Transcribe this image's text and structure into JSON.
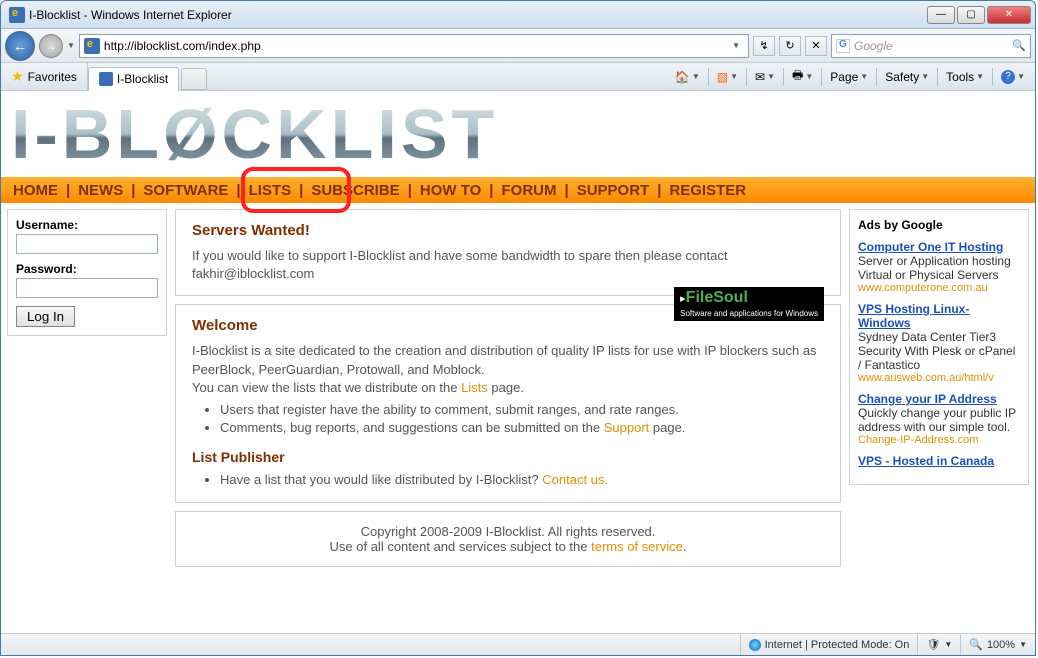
{
  "window": {
    "title": "I-Blocklist - Windows Internet Explorer"
  },
  "address": {
    "url": "http://iblocklist.com/index.php"
  },
  "search": {
    "engine": "Google"
  },
  "favbar": {
    "favorites": "Favorites",
    "tab": "I-Blocklist"
  },
  "toolbar": {
    "page": "Page",
    "safety": "Safety",
    "tools": "Tools"
  },
  "logo": "I-BLØCKLIST",
  "nav": {
    "home": "HOME",
    "news": "NEWS",
    "software": "SOFTWARE",
    "lists": "LISTS",
    "subscribe": "SUBSCRIBE",
    "howto": "HOW TO",
    "forum": "FORUM",
    "support": "SUPPORT",
    "register": "REGISTER"
  },
  "login": {
    "user_label": "Username:",
    "pass_label": "Password:",
    "button": "Log In"
  },
  "servers": {
    "heading": "Servers Wanted!",
    "body": "If you would like to support I-Blocklist and have some bandwidth to spare then please contact fakhir@iblocklist.com"
  },
  "filesoul": {
    "name": "FileSoul",
    "tag": "Software and applications for Windows"
  },
  "welcome": {
    "heading": "Welcome",
    "p1a": "I-Blocklist is a site dedicated to the creation and distribution of quality IP lists for use with IP blockers such as PeerBlock, PeerGuardian, Protowall, and Moblock.",
    "p2a": "You can view the lists that we distribute on the ",
    "p2link": "Lists",
    "p2b": " page.",
    "bullet1": "Users that register have the ability to comment, submit ranges, and rate ranges.",
    "bullet2a": "Comments, bug reports, and suggestions can be submitted on the ",
    "bullet2link": "Support",
    "bullet2b": " page."
  },
  "publisher": {
    "heading": "List Publisher",
    "bullet_a": "Have a list that you would like distributed by I-Blocklist? ",
    "bullet_link": "Contact us."
  },
  "footer": {
    "line1": "Copyright 2008-2009 I-Blocklist. All rights reserved.",
    "line2a": "Use of all content and services subject to the ",
    "line2link": "terms of service",
    "line2b": "."
  },
  "ads": {
    "header": "Ads by Google",
    "items": [
      {
        "title": "Computer One IT Hosting",
        "desc": "Server or Application hosting Virtual or Physical Servers",
        "url": "www.computerone.com.au"
      },
      {
        "title": "VPS Hosting Linux-Windows",
        "desc": "Sydney Data Center Tier3 Security With Plesk or cPanel / Fantastico",
        "url": "www.ausweb.com.au/html/v"
      },
      {
        "title": "Change your IP Address",
        "desc": "Quickly change your public IP address with our simple tool.",
        "url": "Change-IP-Address.com"
      },
      {
        "title": "VPS - Hosted in Canada",
        "desc": "",
        "url": ""
      }
    ]
  },
  "status": {
    "mode": "Internet | Protected Mode: On",
    "zoom": "100%"
  }
}
